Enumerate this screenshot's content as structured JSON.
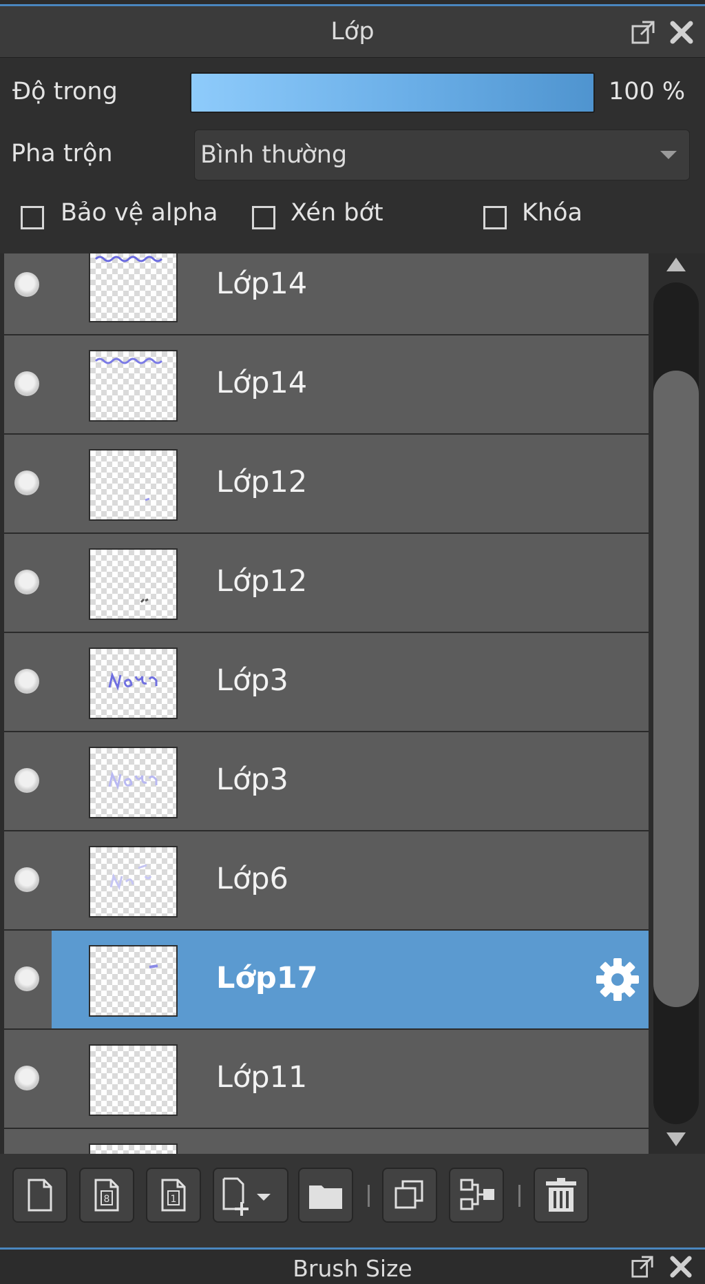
{
  "panel": {
    "title": "Lớp"
  },
  "controls": {
    "opacity_label": "Độ trong",
    "opacity_value": "100 %",
    "opacity_percent": 100,
    "blend_label": "Pha trộn",
    "blend_value": "Bình thường",
    "protect_alpha_label": "Bảo vệ alpha",
    "clipping_label": "Xén bớt",
    "lock_label": "Khóa"
  },
  "layers": [
    {
      "name": "Lớp14"
    },
    {
      "name": "Lớp14"
    },
    {
      "name": "Lớp12"
    },
    {
      "name": "Lớp12"
    },
    {
      "name": "Lớp3"
    },
    {
      "name": "Lớp3"
    },
    {
      "name": "Lớp6"
    },
    {
      "name": "Lớp17",
      "selected": true
    },
    {
      "name": "Lớp11"
    }
  ],
  "toolbar": {
    "icons": [
      "new-layer-icon",
      "new-8bit-layer-icon",
      "new-1bit-layer-icon",
      "add-layer-dropdown-icon",
      "new-folder-icon",
      "duplicate-layer-icon",
      "merge-down-icon",
      "delete-layer-icon"
    ]
  },
  "bottom_panel": {
    "title": "Brush Size"
  },
  "colors": {
    "accent": "#5b9ad0",
    "row_bg": "#5c5c5c",
    "panel_bg": "#2c2c2c"
  }
}
